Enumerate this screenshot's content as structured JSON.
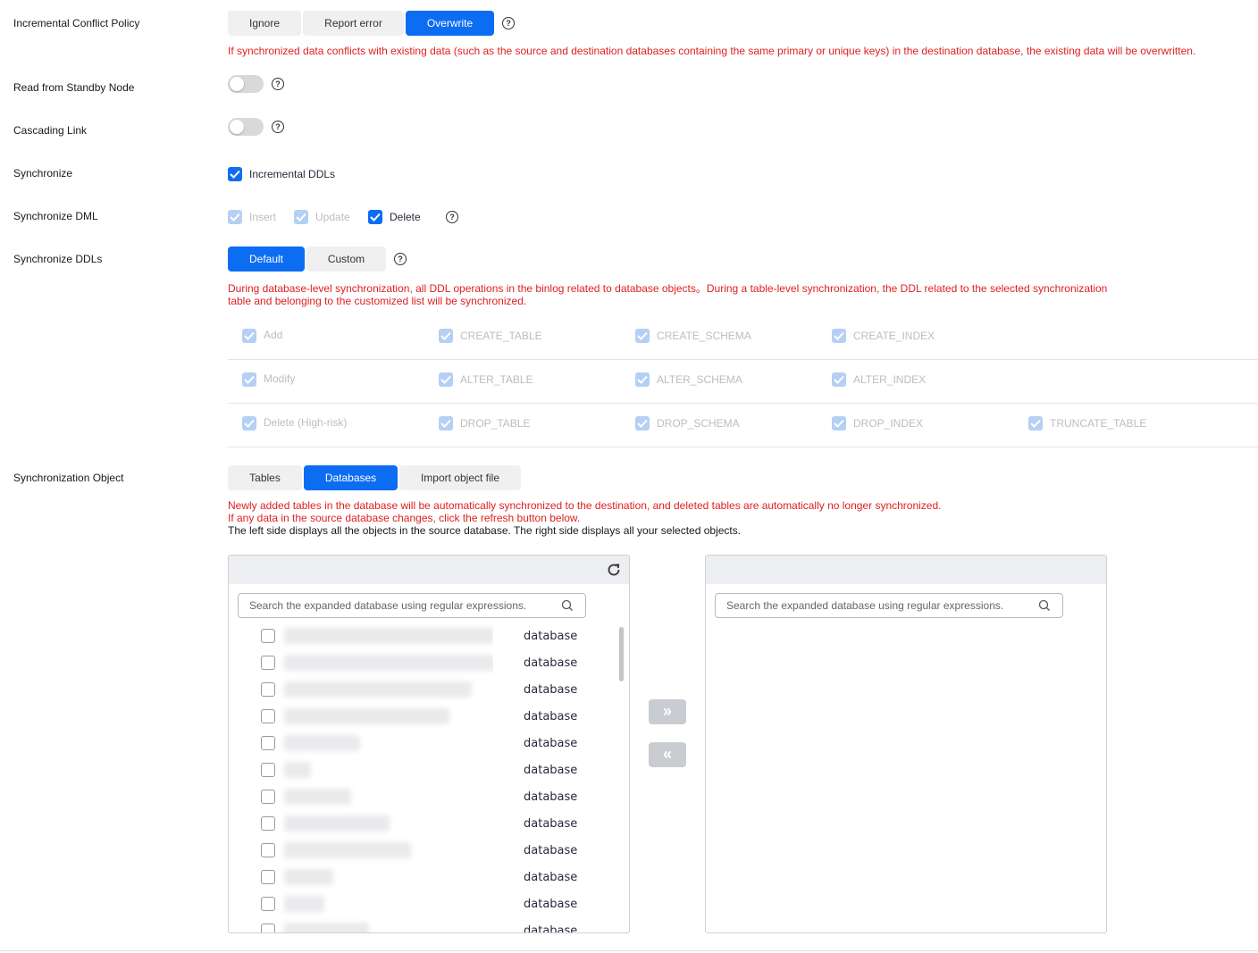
{
  "incremental_conflict": {
    "label": "Incremental Conflict Policy",
    "options": [
      "Ignore",
      "Report error",
      "Overwrite"
    ],
    "selected": "Overwrite",
    "note": "If synchronized data conflicts with existing data (such as the source and destination databases containing the same primary or unique keys) in the destination database, the existing data will be overwritten."
  },
  "standby": {
    "label": "Read from Standby Node",
    "enabled": false
  },
  "cascading": {
    "label": "Cascading Link",
    "enabled": false
  },
  "synchronize": {
    "label": "Synchronize",
    "option": "Incremental DDLs",
    "checked": true
  },
  "sync_dml": {
    "label": "Synchronize DML",
    "insert": "Insert",
    "update": "Update",
    "delete": "Delete"
  },
  "sync_ddls": {
    "label": "Synchronize DDLs",
    "options": [
      "Default",
      "Custom"
    ],
    "selected": "Default",
    "note_line1": "During database-level synchronization, all DDL operations in the binlog related to database objects。During a table-level synchronization, the DDL related to the selected synchronization",
    "note_line2": "table and belonging to the customized list will be synchronized.",
    "rows": [
      [
        "Add",
        "CREATE_TABLE",
        "CREATE_SCHEMA",
        "CREATE_INDEX"
      ],
      [
        "Modify",
        "ALTER_TABLE",
        "ALTER_SCHEMA",
        "ALTER_INDEX"
      ],
      [
        "Delete (High-risk)",
        "DROP_TABLE",
        "DROP_SCHEMA",
        "DROP_INDEX",
        "TRUNCATE_TABLE"
      ]
    ]
  },
  "sync_object": {
    "label": "Synchronization Object",
    "tabs": [
      "Tables",
      "Databases",
      "Import object file"
    ],
    "selected": "Databases",
    "note1": "Newly added tables in the database will be automatically synchronized to the destination, and deleted tables are automatically no longer synchronized.",
    "note2": "If any data in the source database changes, click the refresh button below.",
    "note3": "The left side displays all the objects in the source database. The right side displays all your selected objects.",
    "search_placeholder": "Search the expanded database using regular expressions.",
    "row_type": "database",
    "move_right": "»",
    "move_left": "«"
  },
  "colors": {
    "accent": "#0c6df2",
    "warning": "#e02020",
    "disabled_check": "#b4d0f4"
  },
  "icons": [
    "question-icon",
    "refresh-icon",
    "search-icon",
    "check-icon"
  ]
}
